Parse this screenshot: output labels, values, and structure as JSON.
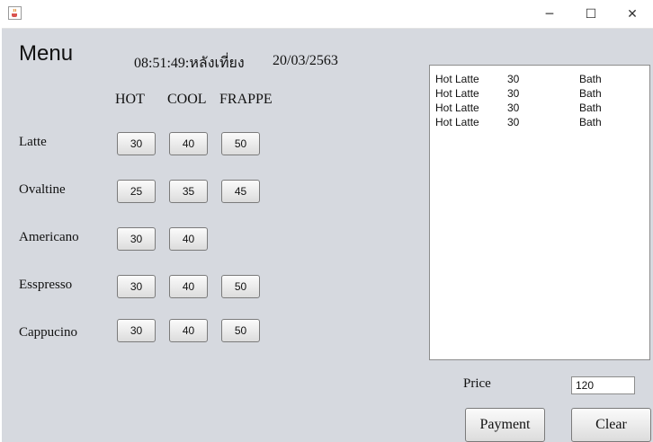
{
  "window": {
    "minimize_glyph": "─",
    "maximize_glyph": "☐",
    "close_glyph": "✕"
  },
  "header": {
    "title": "Menu",
    "time": "08:51:49:หลังเที่ยง",
    "date": "20/03/2563"
  },
  "columns": {
    "hot": "HOT",
    "cool": "COOL",
    "frappe": "FRAPPE"
  },
  "menu": [
    {
      "name": "Latte",
      "hot": "30",
      "cool": "40",
      "frappe": "50"
    },
    {
      "name": "Ovaltine",
      "hot": "25",
      "cool": "35",
      "frappe": "45"
    },
    {
      "name": "Americano",
      "hot": "30",
      "cool": "40"
    },
    {
      "name": "Esspresso",
      "hot": "30",
      "cool": "40",
      "frappe": "50"
    },
    {
      "name": "Cappucino",
      "hot": "30",
      "cool": "40",
      "frappe": "50"
    }
  ],
  "order": [
    {
      "item": "Hot Latte",
      "price": "30",
      "unit": "Bath"
    },
    {
      "item": "Hot Latte",
      "price": "30",
      "unit": "Bath"
    },
    {
      "item": "Hot Latte",
      "price": "30",
      "unit": "Bath"
    },
    {
      "item": "Hot Latte",
      "price": "30",
      "unit": "Bath"
    }
  ],
  "price": {
    "label": "Price",
    "value": "120"
  },
  "actions": {
    "payment": "Payment",
    "clear": "Clear"
  }
}
